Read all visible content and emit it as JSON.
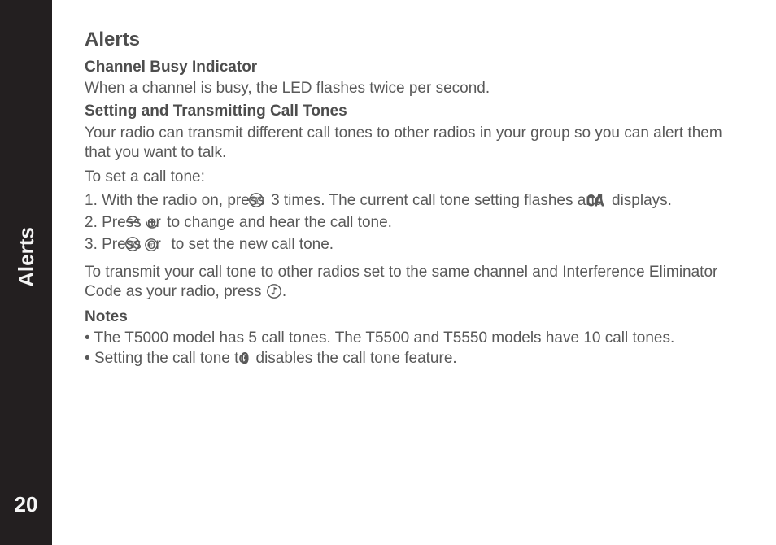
{
  "sidebar": {
    "tab_label": "Alerts",
    "page_number": "20"
  },
  "heading": "Alerts",
  "section1": {
    "title": "Channel Busy Indicator",
    "body": "When a channel is busy, the LED flashes twice per second."
  },
  "section2": {
    "title": "Setting and Transmitting Call Tones",
    "intro": "Your radio can transmit different call tones to other radios in your group so you can alert them that you want to talk.",
    "lead": "To set a call tone:",
    "steps": [
      {
        "num": "1. ",
        "a": "With the radio on, press ",
        "icon1": "menu-lock-icon",
        "b": "3 times. The current call tone setting flashes and ",
        "icon2": "ca-segment-icon",
        "c": " displays."
      },
      {
        "num": "2. ",
        "a": "Press ",
        "icon1": "minus-icon",
        "b": "or ",
        "icon2": "plus-icon",
        "c": "to change and hear the call tone."
      },
      {
        "num": "3. ",
        "a": "Press ",
        "icon1": "menu-lock-icon",
        "b": "or ",
        "icon2": "ptt-icon",
        "c": " to set the new call tone."
      }
    ],
    "transmit_a": "To transmit your call tone to other radios set to the same channel and Interference Eliminator Code as your radio, press ",
    "transmit_icon": "tone-note-icon",
    "transmit_b": "."
  },
  "section3": {
    "title": "Notes",
    "items": [
      {
        "bullet": "• ",
        "a": "The T5000 model has 5 call tones. The T5500 and T5550 models have 10 call tones.",
        "icon": null,
        "b": ""
      },
      {
        "bullet": "• ",
        "a": "Setting the call tone to  ",
        "icon": "zero-segment-icon",
        "b": "  disables the call tone feature."
      }
    ]
  }
}
